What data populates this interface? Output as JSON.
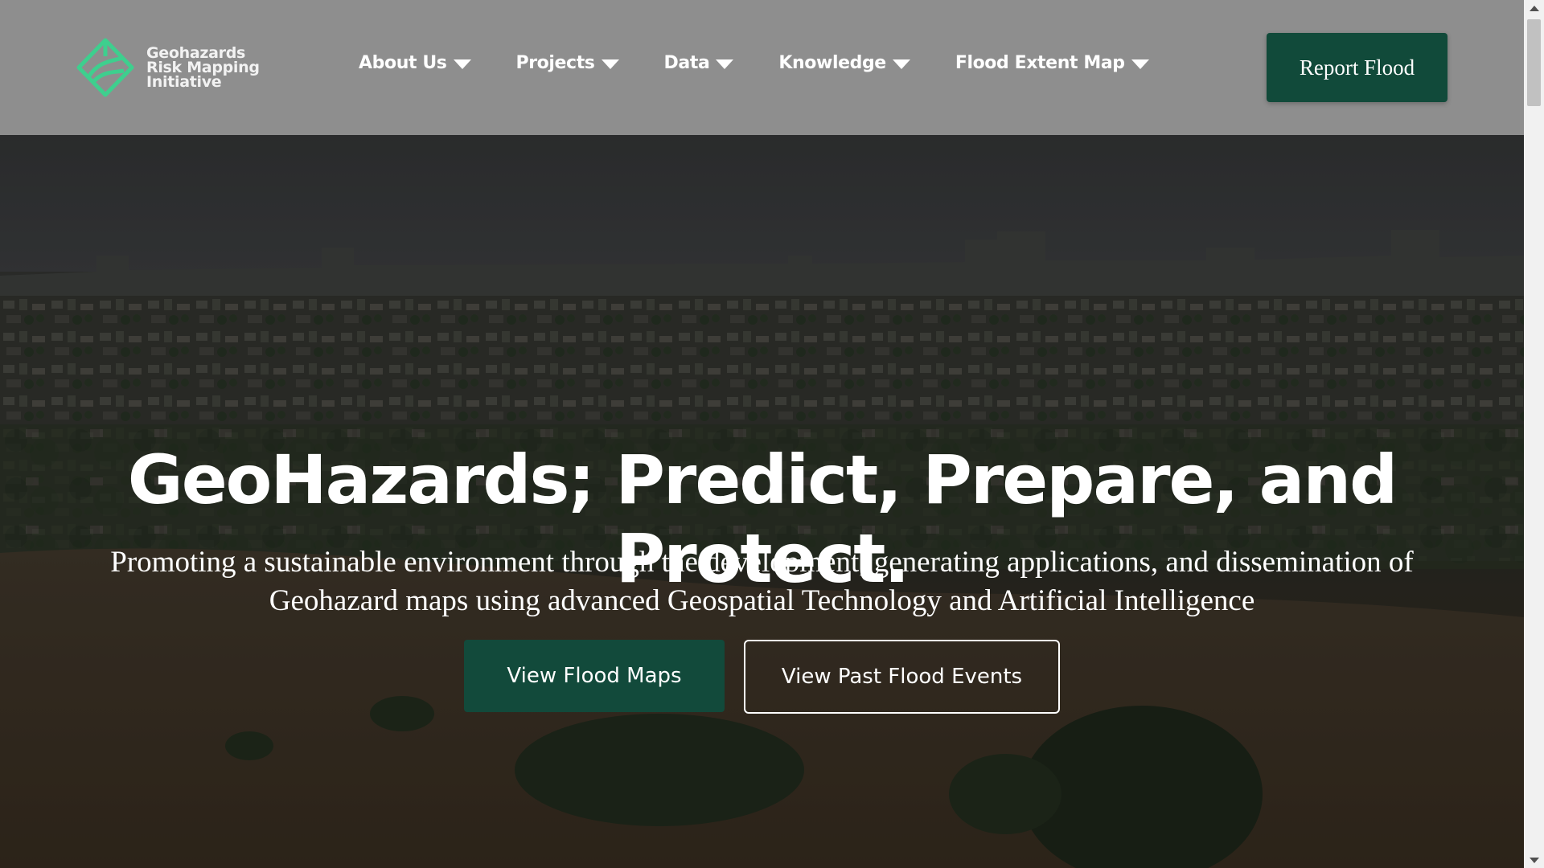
{
  "brand": {
    "name_line1": "Geohazards",
    "name_line2": "Risk Mapping",
    "name_line3": "Initiative",
    "logo_icon": "diamond-map-logo-icon",
    "logo_color": "#3ecf8e"
  },
  "nav": {
    "items": [
      {
        "label": "About Us",
        "icon": "caret-down-icon"
      },
      {
        "label": "Projects",
        "icon": "caret-down-icon"
      },
      {
        "label": "Data",
        "icon": "caret-down-icon"
      },
      {
        "label": "Knowledge",
        "icon": "caret-down-icon"
      },
      {
        "label": "Flood Extent Map",
        "icon": "caret-down-icon"
      }
    ],
    "cta_label": "Report Flood"
  },
  "hero": {
    "title": "GeoHazards; Predict, Prepare, and Protect.",
    "subtitle": "Promoting a sustainable environment through the development, generating applications, and dissemination of Geohazard maps using advanced Geospatial Technology and Artificial Intelligence",
    "primary_button": "View Flood Maps",
    "secondary_button": "View Past Flood Events",
    "background": "aerial-flooded-city-image"
  },
  "colors": {
    "header_bg": "#8e8e8e",
    "brand_green": "#114a3a",
    "text_light": "#ffffff"
  }
}
